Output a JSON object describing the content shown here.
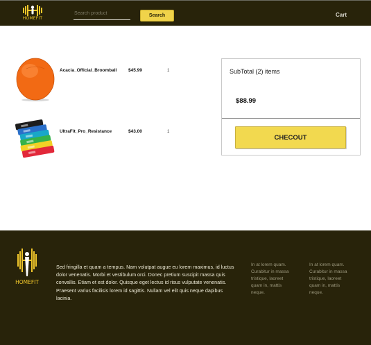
{
  "header": {
    "logo_text": "HOMEFIT",
    "search_placeholder": "Search product",
    "search_button_label": "Search",
    "cart_label": "Cart"
  },
  "cart_items": [
    {
      "name": "Acacia_Official_Broomball",
      "price": "$45.99",
      "quantity": "1",
      "image_icon": "orange-ball-icon"
    },
    {
      "name": "UltraFit_Pro_Resistance",
      "price": "$43.00",
      "quantity": "1",
      "image_icon": "resistance-bands-icon"
    }
  ],
  "summary": {
    "subtotal_label": "SubTotal (2) items",
    "subtotal_value": "$88.99",
    "checkout_label": "CHECOUT"
  },
  "footer": {
    "logo_text": "HOMEFIT",
    "about": "Sed fringilla et quam a tempus. Nam volutpat augue eu lorem maximus, id luctus dolor venenatis. Morbi et vestibulum orci. Donec pretium suscipit massa quis convallis. Etiam et est dolor. Quisque eget lectus id risus vulputate venenatis. Praesent varius facilisis lorem id sagittis. Nullam vel elit quis neque dapibus lacinia.",
    "col1": "In at lorem quam. Curabitur in massa tristique, laoreet quam in, mattis neque.",
    "col2": "In at lorem quam. Curabitur in massa tristique, laoreet quam in, mattis neque."
  },
  "colors": {
    "header_bg": "#28230a",
    "accent_yellow": "#f2d94f",
    "logo_gold": "#f0c62a"
  }
}
